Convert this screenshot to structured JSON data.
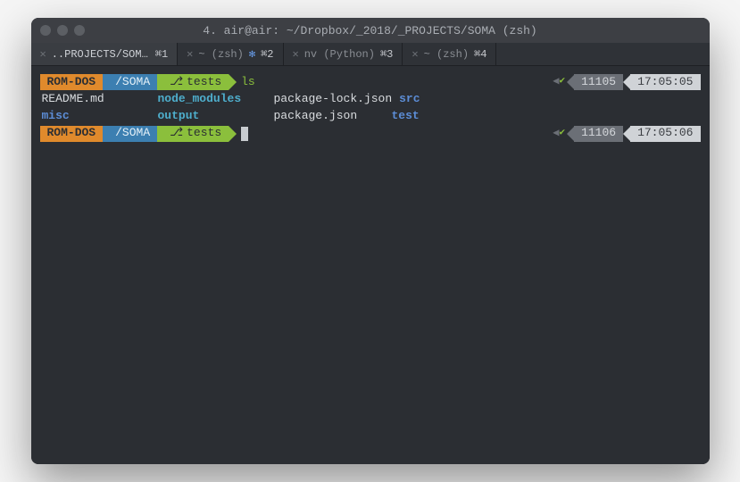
{
  "window": {
    "title": "4. air@air: ~/Dropbox/_2018/_PROJECTS/SOMA (zsh)"
  },
  "tabs": [
    {
      "label": "..PROJECTS/SOMA (…",
      "shortcut": "⌘1",
      "active": true
    },
    {
      "label": "~ (zsh)",
      "shortcut": "⌘2",
      "spinner": true
    },
    {
      "label": "nv (Python)",
      "shortcut": "⌘3"
    },
    {
      "label": "~ (zsh)",
      "shortcut": "⌘4"
    }
  ],
  "prompt": {
    "user": "ROM-DOS",
    "path": "/SOMA",
    "branch_icon": "⎇",
    "branch": "tests"
  },
  "lines": [
    {
      "command": "ls",
      "right": {
        "num": "11105",
        "time": "17:05:05"
      }
    },
    {
      "cursor": true,
      "right": {
        "num": "11106",
        "time": "17:05:06"
      }
    }
  ],
  "ls": {
    "row1": {
      "c1": "README.md",
      "c2": "node_modules",
      "c3a": "package-lock.json",
      "c3b": "src"
    },
    "row2": {
      "c1": "misc",
      "c2": "output",
      "c3a": "package.json",
      "c3b": "test"
    }
  },
  "glyphs": {
    "close": "✕",
    "check": "✔",
    "chevron_left": "◀"
  }
}
